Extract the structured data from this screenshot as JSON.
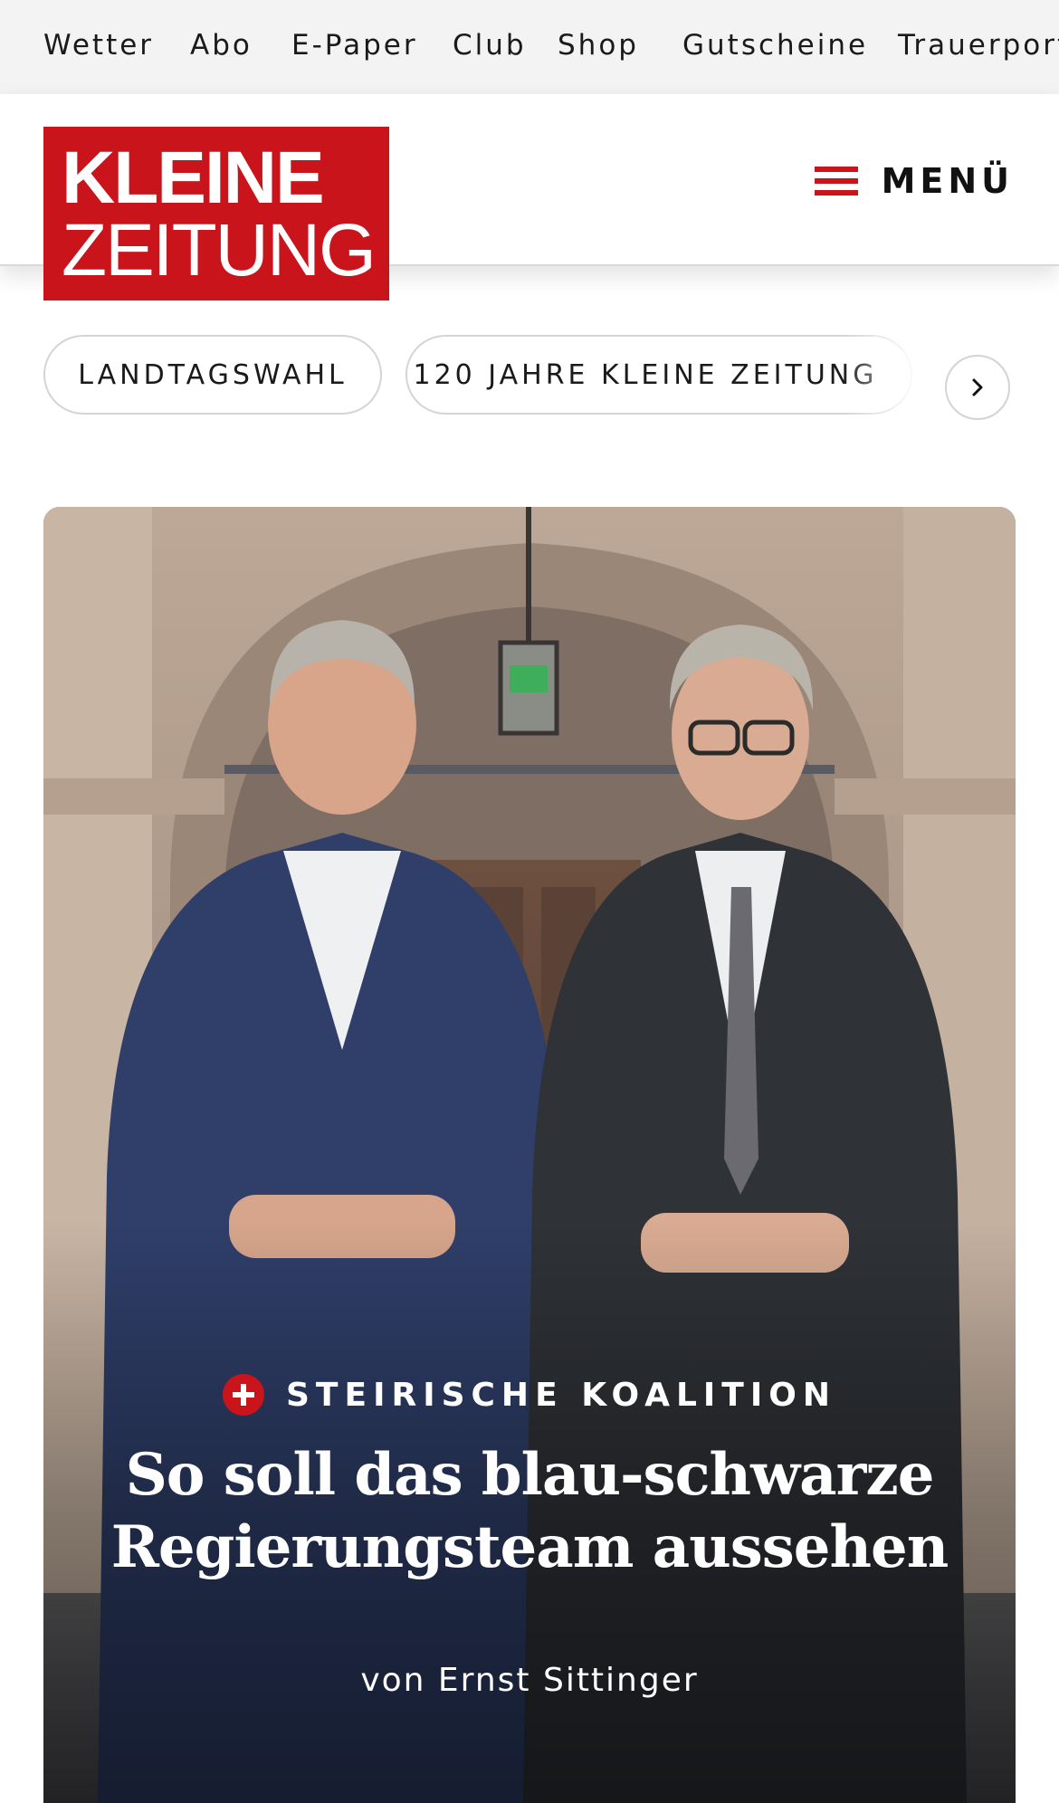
{
  "topbar": {
    "items": [
      "Wetter",
      "Abo",
      "E-Paper",
      "Club",
      "Shop",
      "Gutscheine",
      "Trauerportal"
    ]
  },
  "header": {
    "logo": {
      "line1": "KLEINE",
      "line2": "ZEITUNG"
    },
    "menu_label": "MENÜ"
  },
  "topics": {
    "chips": [
      "LANDTAGSWAHL",
      "120 JAHRE KLEINE ZEITUNG"
    ],
    "next_icon": "chevron-right-icon"
  },
  "hero": {
    "kicker": "STEIRISCHE KOALITION",
    "headline": "So soll das blau-schwarze Regierungsteam aussehen",
    "byline": "von Ernst Sittinger",
    "badge_icon": "plus-icon"
  },
  "colors": {
    "brand_red": "#c8141a",
    "topbar_bg": "#f3f3f3"
  }
}
